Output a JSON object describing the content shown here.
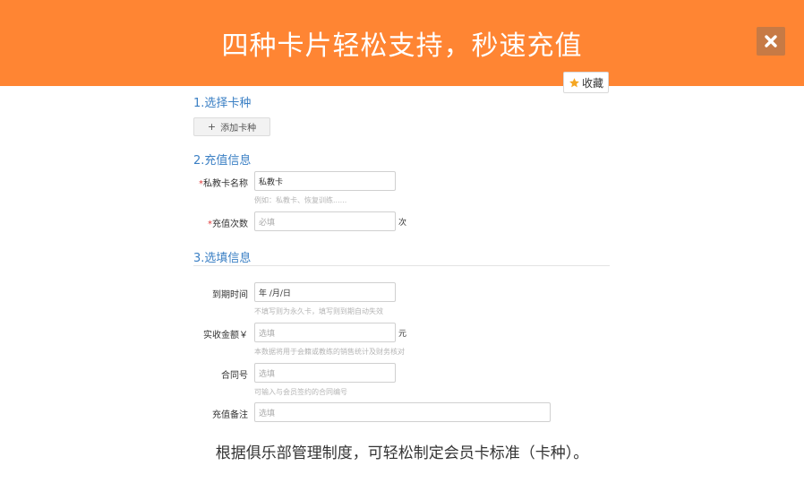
{
  "banner": {
    "title": "四种卡片轻松支持，秒速充值",
    "close_icon": "close-icon",
    "background_color": "#ff8533"
  },
  "favorite_button": {
    "label": "收藏",
    "icon": "star-icon",
    "icon_color": "#f5a623"
  },
  "section1": {
    "title": "1.选择卡种",
    "add_button_label": "添加卡种"
  },
  "section2": {
    "title": "2.充值信息",
    "card_name": {
      "label": "私教卡名称",
      "value": "私教卡",
      "hint": "例如：私教卡、恢复训练......"
    },
    "recharge_count": {
      "label": "充值次数",
      "placeholder": "必填",
      "unit": "次"
    }
  },
  "section3": {
    "title": "3.选填信息",
    "expire": {
      "label": "到期时间",
      "value": "年 /月/日",
      "hint": "不填写则为永久卡，填写则到期自动失效"
    },
    "amount": {
      "label": "实收金额￥",
      "placeholder": "选填",
      "unit": "元",
      "hint": "本数据将用于会籍或教练的销售统计及财务核对"
    },
    "contract": {
      "label": "合同号",
      "placeholder": "选填",
      "hint": "可输入与会员签约的合同编号"
    },
    "remark": {
      "label": "充值备注",
      "placeholder": "选填"
    }
  },
  "footer": {
    "text": "根据俱乐部管理制度，可轻松制定会员卡标准（卡种）。"
  }
}
